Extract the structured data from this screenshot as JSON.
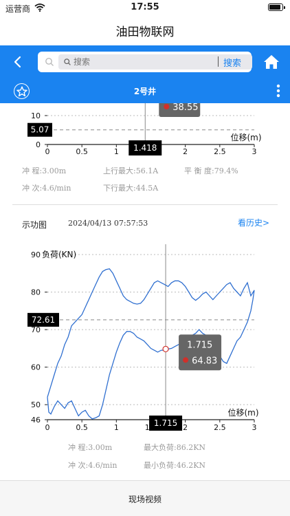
{
  "status": {
    "carrier": "运营商",
    "time": "17:55"
  },
  "app": {
    "title": "油田物联网"
  },
  "search": {
    "placeholder": "搜索",
    "button_label": "搜索"
  },
  "well": {
    "name": "2号井"
  },
  "top_chart": {
    "params": {
      "stroke": "冲 程:3.00m",
      "strokes_per_min": "冲 次:4.6/min",
      "up_max_current": "上行最大:56.1A",
      "down_max_current": "下行最大:44.5A",
      "balance": "平 衡 度:79.4%"
    },
    "cursor_x_label": "1.418",
    "cursor_y_label": "5.07",
    "tooltip_value": "38.55"
  },
  "dyno": {
    "section_title": "示功图",
    "date": "2024/04/13 07:57:53",
    "history_link": "看历史>",
    "params": {
      "stroke": "冲 程:3.00m",
      "strokes_per_min": "冲 次:4.6/min",
      "max_load": "最大负荷:86.2KN",
      "min_load": "最小负荷:46.2KN"
    },
    "cursor_x_label": "1.715",
    "cursor_y_label": "72.61",
    "tooltip_x": "1.715",
    "tooltip_y": "64.83"
  },
  "footer": {
    "video_button": "现场视频"
  },
  "colors": {
    "accent": "#1a83f0",
    "curve": "#2f6fd0",
    "marker": "#d0302a",
    "tooltip_bg": "#666666"
  },
  "chart_data": [
    {
      "type": "line",
      "xlabel": "位移(m)",
      "x_ticks": [
        "0",
        "0.5",
        "1",
        "1.5",
        "2",
        "2.5",
        "3"
      ],
      "y_ticks": [
        "0",
        "10"
      ],
      "xlim": [
        0,
        3
      ],
      "cursor_x": 1.418,
      "cursor_y": 5.07
    },
    {
      "type": "line",
      "ylabel": "负荷(KN)",
      "xlabel": "位移(m)",
      "x_ticks": [
        "0",
        "0.5",
        "1",
        "1.5",
        "2",
        "2.5",
        "3"
      ],
      "y_ticks": [
        "46",
        "50",
        "60",
        "70",
        "80",
        "90"
      ],
      "xlim": [
        0,
        3
      ],
      "ylim": [
        46,
        90
      ],
      "cursor_x": 1.715,
      "cursor_y": 72.61,
      "selected_point": {
        "x": 1.715,
        "y": 64.83
      },
      "x": [
        0.0,
        0.05,
        0.1,
        0.15,
        0.2,
        0.25,
        0.3,
        0.35,
        0.4,
        0.45,
        0.5,
        0.55,
        0.6,
        0.65,
        0.7,
        0.75,
        0.8,
        0.85,
        0.9,
        0.95,
        1.0,
        1.05,
        1.1,
        1.15,
        1.2,
        1.25,
        1.3,
        1.35,
        1.4,
        1.45,
        1.5,
        1.55,
        1.6,
        1.65,
        1.7,
        1.75,
        1.8,
        1.85,
        1.9,
        1.95,
        2.0,
        2.05,
        2.1,
        2.15,
        2.2,
        2.25,
        2.3,
        2.35,
        2.4,
        2.45,
        2.5,
        2.55,
        2.6,
        2.65,
        2.7,
        2.75,
        2.8,
        2.85,
        2.9,
        2.95,
        3.0,
        2.98,
        2.95,
        2.9,
        2.85,
        2.8,
        2.75,
        2.7,
        2.65,
        2.6,
        2.55,
        2.5,
        2.45,
        2.4,
        2.35,
        2.3,
        2.25,
        2.2,
        2.15,
        2.1,
        2.05,
        2.0,
        1.95,
        1.9,
        1.85,
        1.8,
        1.75,
        1.7,
        1.65,
        1.6,
        1.55,
        1.5,
        1.45,
        1.4,
        1.35,
        1.3,
        1.25,
        1.2,
        1.15,
        1.1,
        1.05,
        1.0,
        0.95,
        0.9,
        0.85,
        0.8,
        0.75,
        0.7,
        0.65,
        0.6,
        0.55,
        0.5,
        0.45,
        0.4,
        0.35,
        0.3,
        0.25,
        0.2,
        0.15,
        0.1,
        0.05,
        0.02,
        0.0
      ],
      "y": [
        52,
        55,
        58,
        61,
        63,
        66,
        68,
        71,
        72,
        73,
        74,
        76,
        78,
        80,
        82,
        84,
        85.5,
        86,
        86.2,
        85,
        83,
        81,
        79,
        78,
        77.5,
        77,
        76.8,
        77,
        78,
        79.5,
        81,
        82.5,
        83,
        82.5,
        82,
        81.5,
        82.5,
        83,
        83,
        82.5,
        81.5,
        80,
        78.5,
        77.8,
        78.5,
        79.5,
        80,
        79,
        78,
        79,
        80,
        81,
        82,
        82.5,
        81,
        80,
        79,
        81,
        82.5,
        79,
        80.5,
        78,
        75,
        72,
        70,
        68,
        67,
        65,
        63,
        61,
        61.5,
        63,
        65,
        66.5,
        67.5,
        68.5,
        69,
        70,
        69,
        68.5,
        68,
        67.5,
        66.5,
        66,
        65.5,
        65,
        64.83,
        64.5,
        64.5,
        64,
        64.5,
        65,
        66,
        67,
        67.5,
        68,
        69,
        69.5,
        69.5,
        68.5,
        66.5,
        64,
        61,
        58,
        54,
        50,
        47,
        46.5,
        46.2,
        47,
        48.5,
        48,
        47,
        49,
        51,
        50.5,
        49,
        50,
        51,
        49.5,
        47.5,
        48,
        52
      ]
    }
  ]
}
